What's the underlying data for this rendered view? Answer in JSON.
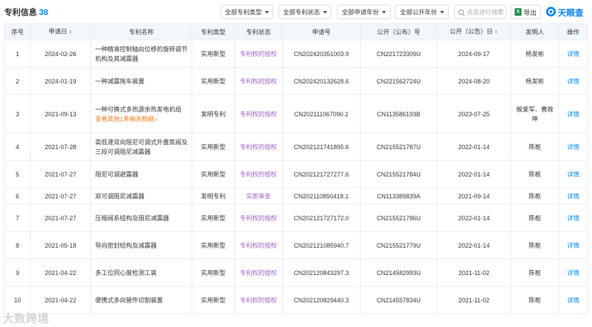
{
  "header": {
    "title": "专利信息",
    "count": "38",
    "filters": [
      "全部专利类型",
      "全部专利状态",
      "全部申请年份",
      "全部公开年份"
    ],
    "search_placeholder": "点击进行搜索",
    "export_label": "导出",
    "excel_glyph": "X",
    "brand": "天眼查"
  },
  "table": {
    "columns": [
      "序号",
      "申请日",
      "专利名称",
      "专利类型",
      "专利状态",
      "申请号",
      "公开（公布）号",
      "公开（公告）日",
      "发明人",
      "操作"
    ],
    "sortable": [
      "申请日",
      "公开（公告）日"
    ],
    "rows": [
      {
        "no": "1",
        "date": "2024-02-26",
        "name": "一种精准控制轴向位移的旋转调节机构及其减震器",
        "more": "",
        "type": "实用新型",
        "status": "专利权的授权",
        "app_no": "CN202420351003.9",
        "pub_no": "CN221723309U",
        "pub_date": "2024-09-17",
        "inventor": "杨发彬",
        "op": "详情"
      },
      {
        "no": "2",
        "date": "2024-01-19",
        "name": "一种减震拖车装置",
        "more": "",
        "type": "实用新型",
        "status": "专利权的授权",
        "app_no": "CN202420132628.6",
        "pub_no": "CN221562724U",
        "pub_date": "2024-08-20",
        "inventor": "杨发彬",
        "op": "详情"
      },
      {
        "no": "3",
        "date": "2021-09-13",
        "name": "一种可换式多热源余热发电机组",
        "more": "查看其他1条相关数据",
        "type": "发明专利",
        "status": "专利权的授权",
        "app_no": "CN202111067090.2",
        "pub_no": "CN113586193B",
        "pub_date": "2023-07-25",
        "inventor": "殷爱军、曹政坤",
        "op": "详情"
      },
      {
        "no": "4",
        "date": "2021-07-28",
        "name": "高低速双向阻尼可调式外置底阀及三段可调阻尼减震器",
        "more": "",
        "type": "实用新型",
        "status": "专利权的授权",
        "app_no": "CN202121741895.6",
        "pub_no": "CN215521787U",
        "pub_date": "2022-01-14",
        "inventor": "陈枢",
        "op": "详情"
      },
      {
        "no": "5",
        "date": "2021-07-27",
        "name": "阻尼可调避震器",
        "more": "",
        "type": "实用新型",
        "status": "专利权的授权",
        "app_no": "CN202121727277.6",
        "pub_no": "CN215521784U",
        "pub_date": "2022-01-14",
        "inventor": "陈枢",
        "op": "详情"
      },
      {
        "no": "6",
        "date": "2021-07-27",
        "name": "双可调阻尼减震器",
        "more": "",
        "type": "发明专利",
        "status": "实质审查",
        "app_no": "CN202110850418.1",
        "pub_no": "CN113389839A",
        "pub_date": "2021-09-14",
        "inventor": "陈枢",
        "op": "详情"
      },
      {
        "no": "7",
        "date": "2021-07-27",
        "name": "压缩阀系结构及阻尼减震器",
        "more": "",
        "type": "实用新型",
        "status": "专利权的授权",
        "app_no": "CN202121727172.0",
        "pub_no": "CN215521786U",
        "pub_date": "2022-01-14",
        "inventor": "陈枢",
        "op": "详情"
      },
      {
        "no": "8",
        "date": "2021-05-18",
        "name": "导向密封结构及减震器",
        "more": "",
        "type": "实用新型",
        "status": "专利权的授权",
        "app_no": "CN202121085940.7",
        "pub_no": "CN215521779U",
        "pub_date": "2022-01-14",
        "inventor": "陈枢",
        "op": "详情"
      },
      {
        "no": "9",
        "date": "2021-04-22",
        "name": "多工位同心度检测工装",
        "more": "",
        "type": "实用新型",
        "status": "专利权的授权",
        "app_no": "CN202120843297.3",
        "pub_no": "CN214582993U",
        "pub_date": "2021-11-02",
        "inventor": "陈枢",
        "op": "详情"
      },
      {
        "no": "10",
        "date": "2021-04-22",
        "name": "便携式多向管件切割装置",
        "more": "",
        "type": "实用新型",
        "status": "专利权的授权",
        "app_no": "CN202120829440.3",
        "pub_no": "CN214557834U",
        "pub_date": "2021-11-02",
        "inventor": "陈枢",
        "op": "详情"
      }
    ]
  },
  "watermark": "大数跨境",
  "colors": {
    "accent": "#0084ff",
    "status": "#a35dd2",
    "more_link": "#ff7a1a",
    "header_bg": "#f3f7fc"
  }
}
